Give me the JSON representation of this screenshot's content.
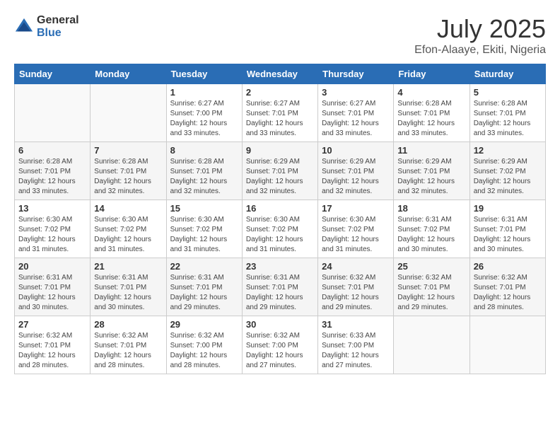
{
  "logo": {
    "general": "General",
    "blue": "Blue"
  },
  "title": {
    "month": "July 2025",
    "location": "Efon-Alaaye, Ekiti, Nigeria"
  },
  "days_of_week": [
    "Sunday",
    "Monday",
    "Tuesday",
    "Wednesday",
    "Thursday",
    "Friday",
    "Saturday"
  ],
  "weeks": [
    [
      {
        "day": "",
        "sunrise": "",
        "sunset": "",
        "daylight": ""
      },
      {
        "day": "",
        "sunrise": "",
        "sunset": "",
        "daylight": ""
      },
      {
        "day": "1",
        "sunrise": "Sunrise: 6:27 AM",
        "sunset": "Sunset: 7:00 PM",
        "daylight": "Daylight: 12 hours and 33 minutes."
      },
      {
        "day": "2",
        "sunrise": "Sunrise: 6:27 AM",
        "sunset": "Sunset: 7:01 PM",
        "daylight": "Daylight: 12 hours and 33 minutes."
      },
      {
        "day": "3",
        "sunrise": "Sunrise: 6:27 AM",
        "sunset": "Sunset: 7:01 PM",
        "daylight": "Daylight: 12 hours and 33 minutes."
      },
      {
        "day": "4",
        "sunrise": "Sunrise: 6:28 AM",
        "sunset": "Sunset: 7:01 PM",
        "daylight": "Daylight: 12 hours and 33 minutes."
      },
      {
        "day": "5",
        "sunrise": "Sunrise: 6:28 AM",
        "sunset": "Sunset: 7:01 PM",
        "daylight": "Daylight: 12 hours and 33 minutes."
      }
    ],
    [
      {
        "day": "6",
        "sunrise": "Sunrise: 6:28 AM",
        "sunset": "Sunset: 7:01 PM",
        "daylight": "Daylight: 12 hours and 33 minutes."
      },
      {
        "day": "7",
        "sunrise": "Sunrise: 6:28 AM",
        "sunset": "Sunset: 7:01 PM",
        "daylight": "Daylight: 12 hours and 32 minutes."
      },
      {
        "day": "8",
        "sunrise": "Sunrise: 6:28 AM",
        "sunset": "Sunset: 7:01 PM",
        "daylight": "Daylight: 12 hours and 32 minutes."
      },
      {
        "day": "9",
        "sunrise": "Sunrise: 6:29 AM",
        "sunset": "Sunset: 7:01 PM",
        "daylight": "Daylight: 12 hours and 32 minutes."
      },
      {
        "day": "10",
        "sunrise": "Sunrise: 6:29 AM",
        "sunset": "Sunset: 7:01 PM",
        "daylight": "Daylight: 12 hours and 32 minutes."
      },
      {
        "day": "11",
        "sunrise": "Sunrise: 6:29 AM",
        "sunset": "Sunset: 7:01 PM",
        "daylight": "Daylight: 12 hours and 32 minutes."
      },
      {
        "day": "12",
        "sunrise": "Sunrise: 6:29 AM",
        "sunset": "Sunset: 7:02 PM",
        "daylight": "Daylight: 12 hours and 32 minutes."
      }
    ],
    [
      {
        "day": "13",
        "sunrise": "Sunrise: 6:30 AM",
        "sunset": "Sunset: 7:02 PM",
        "daylight": "Daylight: 12 hours and 31 minutes."
      },
      {
        "day": "14",
        "sunrise": "Sunrise: 6:30 AM",
        "sunset": "Sunset: 7:02 PM",
        "daylight": "Daylight: 12 hours and 31 minutes."
      },
      {
        "day": "15",
        "sunrise": "Sunrise: 6:30 AM",
        "sunset": "Sunset: 7:02 PM",
        "daylight": "Daylight: 12 hours and 31 minutes."
      },
      {
        "day": "16",
        "sunrise": "Sunrise: 6:30 AM",
        "sunset": "Sunset: 7:02 PM",
        "daylight": "Daylight: 12 hours and 31 minutes."
      },
      {
        "day": "17",
        "sunrise": "Sunrise: 6:30 AM",
        "sunset": "Sunset: 7:02 PM",
        "daylight": "Daylight: 12 hours and 31 minutes."
      },
      {
        "day": "18",
        "sunrise": "Sunrise: 6:31 AM",
        "sunset": "Sunset: 7:02 PM",
        "daylight": "Daylight: 12 hours and 30 minutes."
      },
      {
        "day": "19",
        "sunrise": "Sunrise: 6:31 AM",
        "sunset": "Sunset: 7:01 PM",
        "daylight": "Daylight: 12 hours and 30 minutes."
      }
    ],
    [
      {
        "day": "20",
        "sunrise": "Sunrise: 6:31 AM",
        "sunset": "Sunset: 7:01 PM",
        "daylight": "Daylight: 12 hours and 30 minutes."
      },
      {
        "day": "21",
        "sunrise": "Sunrise: 6:31 AM",
        "sunset": "Sunset: 7:01 PM",
        "daylight": "Daylight: 12 hours and 30 minutes."
      },
      {
        "day": "22",
        "sunrise": "Sunrise: 6:31 AM",
        "sunset": "Sunset: 7:01 PM",
        "daylight": "Daylight: 12 hours and 29 minutes."
      },
      {
        "day": "23",
        "sunrise": "Sunrise: 6:31 AM",
        "sunset": "Sunset: 7:01 PM",
        "daylight": "Daylight: 12 hours and 29 minutes."
      },
      {
        "day": "24",
        "sunrise": "Sunrise: 6:32 AM",
        "sunset": "Sunset: 7:01 PM",
        "daylight": "Daylight: 12 hours and 29 minutes."
      },
      {
        "day": "25",
        "sunrise": "Sunrise: 6:32 AM",
        "sunset": "Sunset: 7:01 PM",
        "daylight": "Daylight: 12 hours and 29 minutes."
      },
      {
        "day": "26",
        "sunrise": "Sunrise: 6:32 AM",
        "sunset": "Sunset: 7:01 PM",
        "daylight": "Daylight: 12 hours and 28 minutes."
      }
    ],
    [
      {
        "day": "27",
        "sunrise": "Sunrise: 6:32 AM",
        "sunset": "Sunset: 7:01 PM",
        "daylight": "Daylight: 12 hours and 28 minutes."
      },
      {
        "day": "28",
        "sunrise": "Sunrise: 6:32 AM",
        "sunset": "Sunset: 7:01 PM",
        "daylight": "Daylight: 12 hours and 28 minutes."
      },
      {
        "day": "29",
        "sunrise": "Sunrise: 6:32 AM",
        "sunset": "Sunset: 7:00 PM",
        "daylight": "Daylight: 12 hours and 28 minutes."
      },
      {
        "day": "30",
        "sunrise": "Sunrise: 6:32 AM",
        "sunset": "Sunset: 7:00 PM",
        "daylight": "Daylight: 12 hours and 27 minutes."
      },
      {
        "day": "31",
        "sunrise": "Sunrise: 6:33 AM",
        "sunset": "Sunset: 7:00 PM",
        "daylight": "Daylight: 12 hours and 27 minutes."
      },
      {
        "day": "",
        "sunrise": "",
        "sunset": "",
        "daylight": ""
      },
      {
        "day": "",
        "sunrise": "",
        "sunset": "",
        "daylight": ""
      }
    ]
  ]
}
